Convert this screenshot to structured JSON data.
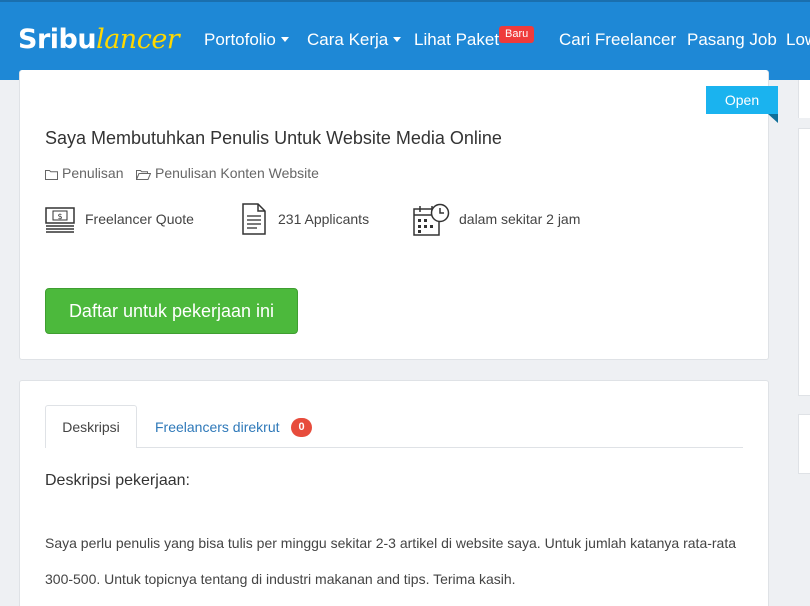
{
  "navbar": {
    "logo_part1": "Sribu",
    "logo_part2": "lancer",
    "items": [
      "Portofolio",
      "Cara Kerja",
      "Lihat Paket",
      "Cari Freelancer",
      "Pasang Job",
      "Low"
    ],
    "new_badge": "Baru"
  },
  "job": {
    "status": "Open",
    "title": "Saya Membutuhkan Penulis Untuk Website Media Online",
    "category": "Penulisan",
    "subcategory": "Penulisan Konten Website",
    "budget_type": "Freelancer Quote",
    "applicants": "231 Applicants",
    "posted": "dalam sekitar 2 jam",
    "apply_label": "Daftar untuk pekerjaan ini"
  },
  "tabs": {
    "description": "Deskripsi",
    "hired": "Freelancers direkrut",
    "hired_count": "0"
  },
  "description": {
    "heading": "Deskripsi pekerjaan:",
    "body": "Saya perlu penulis yang bisa tulis per minggu sekitar 2-3 artikel di website saya. Untuk jumlah katanya rata-rata 300-500. Untuk topicnya tentang di industri makanan and tips. Terima kasih."
  },
  "colors": {
    "navbar": "#1e88d6",
    "logo_accent": "#ffd800",
    "apply_button": "#4cb93c",
    "status_ribbon": "#1ab3ef",
    "badge": "#e74c3c"
  }
}
